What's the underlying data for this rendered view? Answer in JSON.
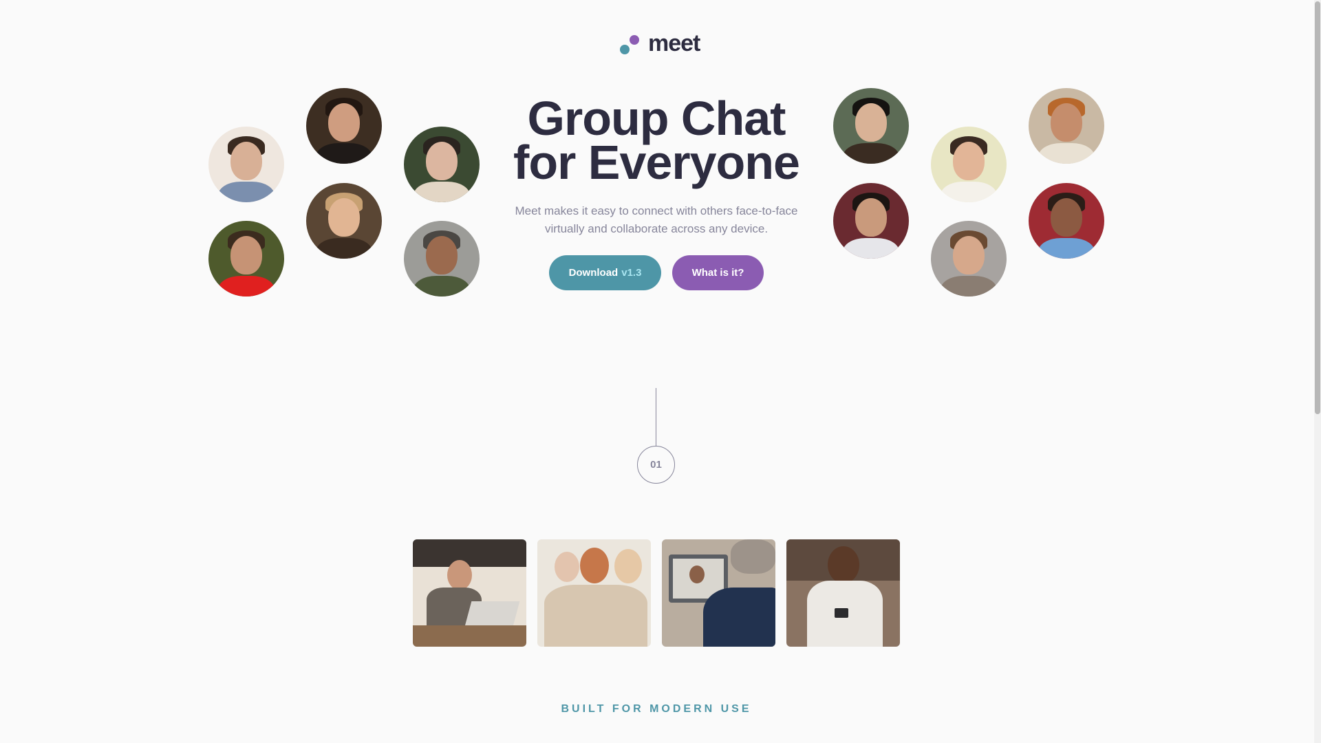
{
  "logo": {
    "text": "meet",
    "colors": {
      "dot_teal": "#4e96a7",
      "dot_purple": "#8b5cb2"
    }
  },
  "hero": {
    "title_line1": "Group Chat",
    "title_line2": "for Everyone",
    "description": "Meet makes it easy to connect with others face-to-face virtually and collaborate across any device.",
    "download_label": "Download",
    "download_version": "v1.3",
    "what_label": "What is it?"
  },
  "avatars": [
    {
      "icon": "person-avatar-icon"
    },
    {
      "icon": "person-avatar-icon"
    },
    {
      "icon": "person-avatar-icon"
    },
    {
      "icon": "person-avatar-icon"
    },
    {
      "icon": "person-avatar-icon"
    },
    {
      "icon": "person-avatar-icon"
    },
    {
      "icon": "person-avatar-icon"
    },
    {
      "icon": "person-avatar-icon"
    },
    {
      "icon": "person-avatar-icon"
    },
    {
      "icon": "person-avatar-icon"
    },
    {
      "icon": "person-avatar-icon"
    },
    {
      "icon": "person-avatar-icon"
    }
  ],
  "step": {
    "number": "01"
  },
  "photos": [
    {
      "icon": "woman-laptop-photo"
    },
    {
      "icon": "women-phone-photo"
    },
    {
      "icon": "video-call-photo"
    },
    {
      "icon": "man-phone-photo"
    }
  ],
  "section": {
    "label": "BUILT FOR MODERN USE"
  },
  "colors": {
    "background": "#fafafa",
    "heading": "#2d2c40",
    "body_text": "#86859a",
    "accent_teal": "#4e96a7",
    "accent_purple": "#8b5cb2"
  }
}
